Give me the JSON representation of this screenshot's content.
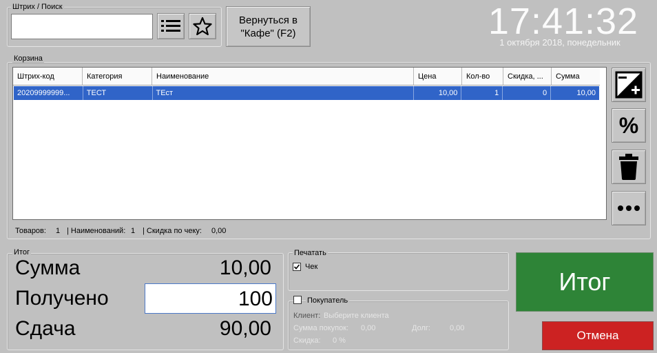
{
  "search": {
    "label": "Штрих / Поиск",
    "value": "",
    "placeholder": ""
  },
  "toolbar": {
    "back_button": "Вернуться в \"Кафе\" (F2)"
  },
  "clock": {
    "time": "17:41:32",
    "date": "1 октября 2018, понедельник"
  },
  "cart": {
    "label": "Корзина",
    "columns": [
      "Штрих-код",
      "Категория",
      "Наименование",
      "Цена",
      "Кол-во",
      "Скидка, ...",
      "Сумма"
    ],
    "rows": [
      {
        "barcode": "20209999999...",
        "category": "ТЕСТ",
        "name": "ТЕст",
        "price": "10,00",
        "qty": "1",
        "discount": "0",
        "sum": "10,00"
      }
    ],
    "status": {
      "goods_label": "Товаров:",
      "goods_value": "1",
      "names_label": "| Наименований:",
      "names_value": "1",
      "discount_label": "| Скидка по чеку:",
      "discount_value": "0,00"
    }
  },
  "totals": {
    "label": "Итог",
    "sum_label": "Сумма",
    "sum_value": "10,00",
    "received_label": "Получено",
    "received_value": "100",
    "change_label": "Сдача",
    "change_value": "90,00"
  },
  "print": {
    "label": "Печатать",
    "check_label": "Чек",
    "check_checked": true
  },
  "customer": {
    "label": "Покупатель",
    "checked": false,
    "client_label": "Клиент:",
    "client_value": "Выберите клиента",
    "purchases_label": "Сумма покупок:",
    "purchases_value": "0,00",
    "debt_label": "Долг:",
    "debt_value": "0,00",
    "discount_label": "Скидка:",
    "discount_value": "0 %"
  },
  "actions": {
    "total_button": "Итог",
    "cancel_button": "Отмена"
  },
  "colors": {
    "total_green": "#2e8437",
    "cancel_red": "#cc2222",
    "selection_blue": "#3064c8"
  }
}
